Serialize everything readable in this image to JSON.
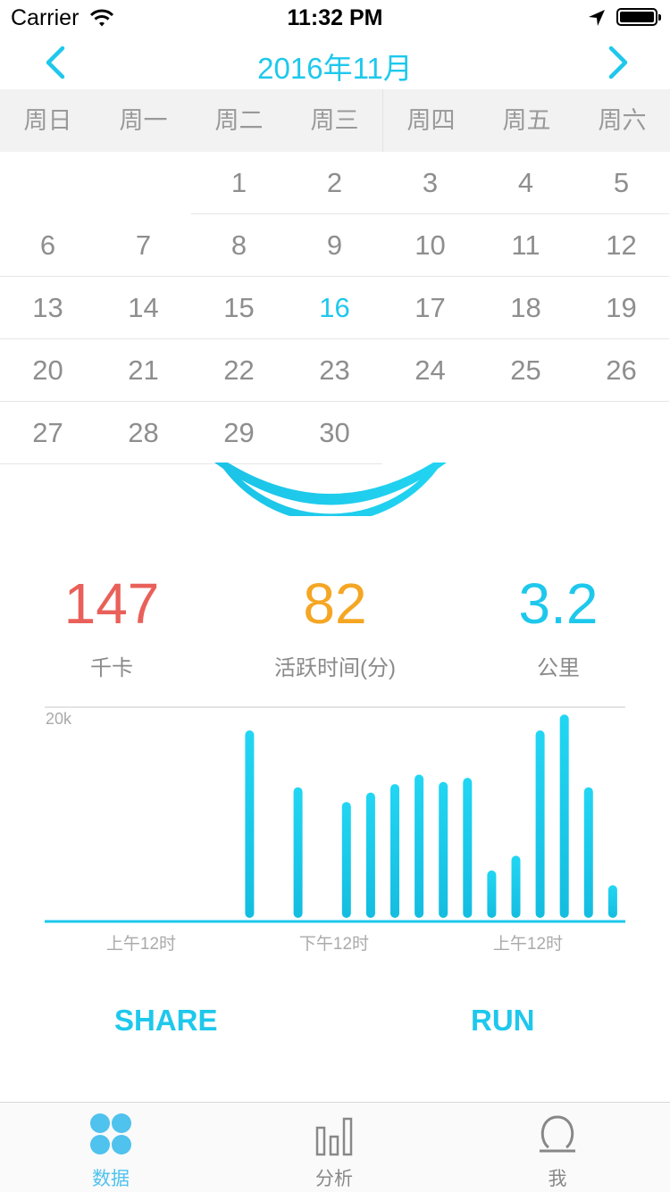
{
  "status_bar": {
    "carrier": "Carrier",
    "time": "11:32 PM"
  },
  "calendar": {
    "title": "2016年11月",
    "weekdays": [
      "周日",
      "周一",
      "周二",
      "周三",
      "周四",
      "周五",
      "周六"
    ],
    "weeks": [
      [
        "",
        "",
        "1",
        "2",
        "3",
        "4",
        "5"
      ],
      [
        "6",
        "7",
        "8",
        "9",
        "10",
        "11",
        "12"
      ],
      [
        "13",
        "14",
        "15",
        "16",
        "17",
        "18",
        "19"
      ],
      [
        "20",
        "21",
        "22",
        "23",
        "24",
        "25",
        "26"
      ],
      [
        "27",
        "28",
        "29",
        "30",
        "",
        "",
        ""
      ]
    ],
    "selected_day": "16"
  },
  "stats": {
    "calories": {
      "value": "147",
      "label": "千卡",
      "color": "#e9605a"
    },
    "active_time": {
      "value": "82",
      "label": "活跃时间(分)",
      "color": "#f5a623"
    },
    "distance": {
      "value": "3.2",
      "label": "公里",
      "color": "#1ec8ec"
    }
  },
  "chart_data": {
    "type": "bar",
    "ymax_label": "20k",
    "ylim": [
      0,
      20000
    ],
    "x_tick_labels": [
      "上午12时",
      "下午12时",
      "上午12时"
    ],
    "values": [
      0,
      0,
      0,
      0,
      17800,
      0,
      12400,
      0,
      11000,
      11900,
      12700,
      13600,
      12900,
      13300,
      4500,
      5900,
      17800,
      19300,
      12400,
      3100,
      0,
      0,
      0,
      0
    ],
    "color": "#1ec8ec"
  },
  "actions": {
    "share": "SHARE",
    "run": "RUN"
  },
  "tabbar": {
    "tabs": [
      {
        "label": "数据",
        "icon": "data-icon"
      },
      {
        "label": "分析",
        "icon": "bar-chart-icon"
      },
      {
        "label": "我",
        "icon": "profile-icon"
      }
    ]
  }
}
